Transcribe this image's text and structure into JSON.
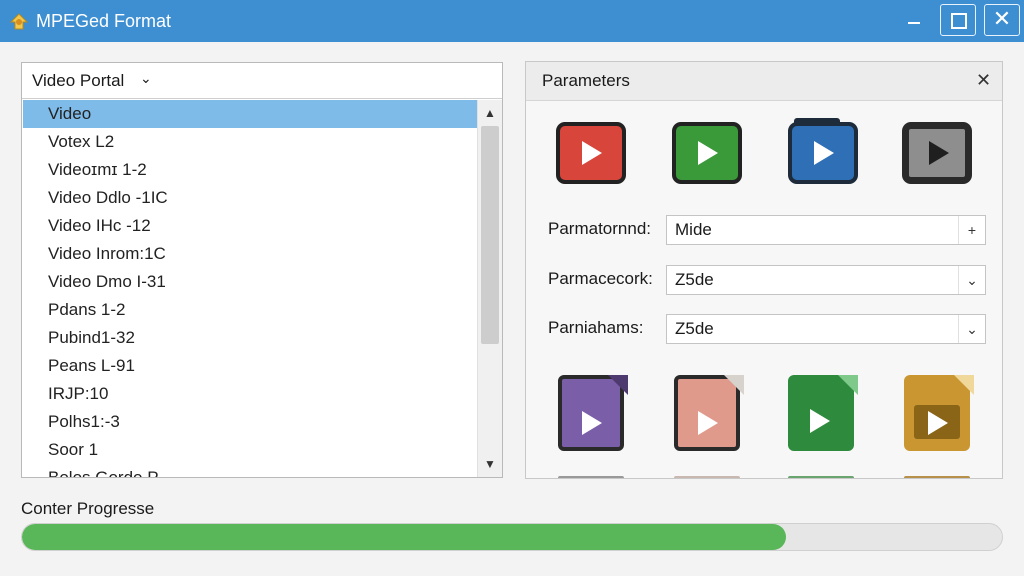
{
  "window": {
    "title": "MPEGed Format",
    "close_glyph": "✕"
  },
  "left_panel": {
    "dropdown_label": "Video Portal",
    "dropdown_chevron": "⌄",
    "items": [
      "Video",
      "Votex L2",
      "Videoɪmɪ 1-2",
      "Video Ddlo -1IC",
      "Video IHc -12",
      "Video Inrom:1C",
      "Video Dmo I-31",
      "Pdans 1-2",
      "Pubind1-32",
      "Peans L-91",
      "IRJP:10",
      "Polhs1:-3",
      "Soor 1",
      "Bolos Gordo P"
    ],
    "selected_index": 0,
    "scroll_up_glyph": "▲",
    "scroll_down_glyph": "▼"
  },
  "parameters": {
    "title": "Parameters",
    "close_glyph": "✕",
    "video_icons": [
      {
        "name": "red-video-icon",
        "color": "#d8453b"
      },
      {
        "name": "green-video-icon",
        "color": "#3a9a3a"
      },
      {
        "name": "blue-video-icon",
        "color": "#2f6fb5"
      },
      {
        "name": "gray-video-icon",
        "color": "#8e8e8e"
      }
    ],
    "rows": [
      {
        "label": "Parmatornnd:",
        "value": "Mide",
        "button_glyph": "+"
      },
      {
        "label": "Parmacecork:",
        "value": "Z5de",
        "button_glyph": "⌄"
      },
      {
        "label": "Parniahams:",
        "value": "Z5de",
        "button_glyph": "⌄"
      }
    ],
    "file_icons": [
      {
        "name": "purple-video-file-icon",
        "color": "#7b5ea8"
      },
      {
        "name": "pink-video-file-icon",
        "color": "#e09a8c"
      },
      {
        "name": "green-video-file-icon",
        "color": "#2e8b3d"
      },
      {
        "name": "gold-video-file-icon",
        "color": "#c99632"
      }
    ]
  },
  "progress": {
    "label": "Conter Progresse",
    "percent": 78,
    "color": "#59b659"
  }
}
